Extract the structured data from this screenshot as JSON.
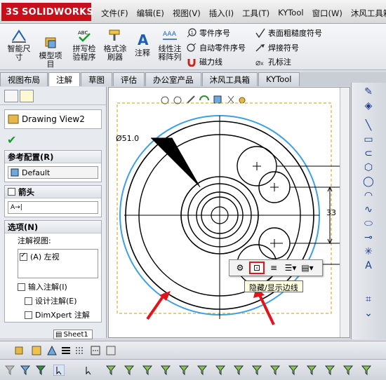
{
  "app": {
    "name": "SOLIDWORKS",
    "ds": "3S"
  },
  "menu": [
    "文件(F)",
    "编辑(E)",
    "视图(V)",
    "插入(I)",
    "工具(T)",
    "KYTool",
    "窗口(W)",
    "沐风工具箱"
  ],
  "ribbon": {
    "smart_dim": "智能尺\n寸",
    "model_items": "模型项\n目",
    "spell_check": "拼写检\n验程序",
    "format_painter": "格式涂\n刷器",
    "note": "注释",
    "linear_note_pattern": "线性注\n释阵列",
    "balloon": "零件序号",
    "auto_balloon": "自动零件序号",
    "magnetic_line": "磁力线",
    "surface_finish": "表面粗糙度符号",
    "weld_symbol": "焊接符号",
    "hole_callout": "孔标注"
  },
  "tabs": [
    "视图布局",
    "注解",
    "草图",
    "评估",
    "办公室产品",
    "沐风工具箱",
    "KYTool"
  ],
  "active_tab": "注解",
  "panel": {
    "title": "Drawing View2",
    "ref_config_header": "参考配置(R)",
    "ref_config_value": "Default",
    "arrow_header": "箭头",
    "options_header": "选项(N)",
    "annotation_view_label": "注解视图:",
    "annotation_view_item": "(A) 左视",
    "import_annotations": "输入注解(I)",
    "design_annotations": "设计注解(E)",
    "dimxpert_annotations": "DimXpert 注解"
  },
  "sheet_tab": "Sheet1",
  "drawing": {
    "diameter_label": "Ø51.0",
    "dim_33": "33",
    "dim_5": "5"
  },
  "tooltip": "隐藏/显示边线",
  "colors": {
    "accent_red": "#e0141a",
    "logo_red": "#c8101d",
    "circle_blue": "#3fa0e0"
  },
  "icons": {
    "left_panel_tab1": "feature-manager-icon",
    "left_panel_tab2": "property-manager-icon",
    "popup_highlight": "hide-show-edges-icon"
  }
}
